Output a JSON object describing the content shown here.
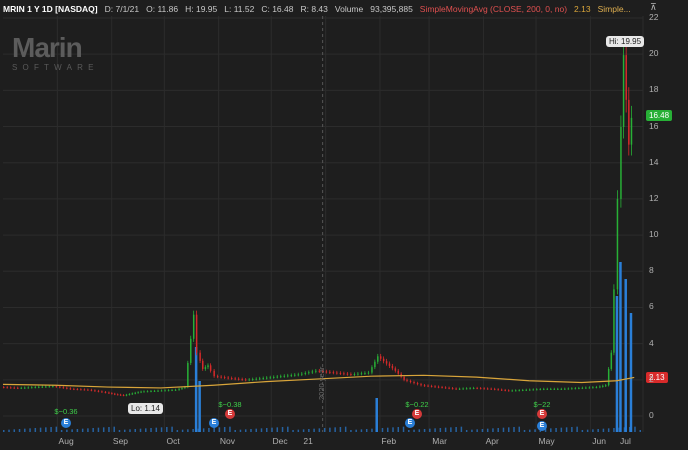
{
  "header": {
    "symbol": "MRIN 1 Y 1D [NASDAQ]",
    "date": "D: 7/1/21",
    "open": "O: 11.86",
    "high": "H: 19.95",
    "low": "L: 11.52",
    "close": "C: 16.48",
    "range": "R: 8.43",
    "volume_label": "Volume",
    "volume_value": "93,395,885",
    "study": "SimpleMovingAvg (CLOSE, 200, 0, no)",
    "study_value": "2.13",
    "study_tail": "Simple..."
  },
  "logo": {
    "word": "Marin",
    "sub": "SOFTWARE"
  },
  "corner_icon": "collapse-icon",
  "price_axis": {
    "ticks": [
      "22",
      "20",
      "18",
      "16",
      "14",
      "12",
      "10",
      "8",
      "6",
      "4",
      "2",
      "0"
    ],
    "last_price": "16.48",
    "sma_price": "2.13"
  },
  "time_axis": {
    "months": [
      "Aug",
      "Sep",
      "Oct",
      "Nov",
      "Dec",
      "21",
      "Feb",
      "Mar",
      "Apr",
      "May",
      "Jun",
      "Jul"
    ],
    "year_marker": "2020 year"
  },
  "annotations": {
    "hi": "Hi: 19.95",
    "lo": "Lo: 1.14",
    "eps": [
      "$−0.36",
      "$−0.38",
      "$−0.22",
      "$−22"
    ]
  },
  "colors": {
    "background": "#1e1e1e",
    "up": "#27b036",
    "down": "#d82a2a",
    "volume": "#2a7fd8",
    "sma": "#d9a53a",
    "grid": "#2c2c2c"
  },
  "chart_data": {
    "type": "line",
    "x_start": "2020-07-01",
    "x_end": "2021-07-01",
    "ylim": [
      0,
      22
    ],
    "price": [
      [
        0,
        1.6
      ],
      [
        10,
        1.55
      ],
      [
        20,
        1.6
      ],
      [
        30,
        1.65
      ],
      [
        40,
        1.5
      ],
      [
        50,
        1.45
      ],
      [
        60,
        1.3
      ],
      [
        65,
        1.2
      ],
      [
        70,
        1.14
      ],
      [
        75,
        1.25
      ],
      [
        80,
        1.35
      ],
      [
        90,
        1.4
      ],
      [
        100,
        1.45
      ],
      [
        105,
        1.6
      ],
      [
        110,
        5.6
      ],
      [
        112,
        3.5
      ],
      [
        115,
        2.6
      ],
      [
        118,
        2.8
      ],
      [
        122,
        2.2
      ],
      [
        130,
        2.1
      ],
      [
        140,
        2.0
      ],
      [
        150,
        2.1
      ],
      [
        160,
        2.2
      ],
      [
        170,
        2.3
      ],
      [
        180,
        2.5
      ],
      [
        190,
        2.4
      ],
      [
        200,
        2.3
      ],
      [
        210,
        2.4
      ],
      [
        215,
        3.3
      ],
      [
        220,
        2.9
      ],
      [
        225,
        2.5
      ],
      [
        230,
        2.0
      ],
      [
        240,
        1.7
      ],
      [
        250,
        1.6
      ],
      [
        260,
        1.5
      ],
      [
        270,
        1.55
      ],
      [
        280,
        1.5
      ],
      [
        290,
        1.4
      ],
      [
        300,
        1.45
      ],
      [
        310,
        1.5
      ],
      [
        320,
        1.5
      ],
      [
        330,
        1.55
      ],
      [
        340,
        1.6
      ],
      [
        345,
        1.7
      ],
      [
        348,
        3.5
      ],
      [
        350,
        7.0
      ],
      [
        352,
        12.0
      ],
      [
        355,
        19.95
      ],
      [
        358,
        15.0
      ],
      [
        360,
        16.48
      ]
    ],
    "sma": [
      [
        0,
        1.75
      ],
      [
        30,
        1.7
      ],
      [
        60,
        1.6
      ],
      [
        90,
        1.55
      ],
      [
        120,
        1.7
      ],
      [
        150,
        1.9
      ],
      [
        180,
        2.05
      ],
      [
        210,
        2.2
      ],
      [
        240,
        2.25
      ],
      [
        270,
        2.15
      ],
      [
        300,
        1.95
      ],
      [
        330,
        1.85
      ],
      [
        350,
        1.95
      ],
      [
        360,
        2.13
      ]
    ],
    "volume_spikes": [
      [
        110,
        0.5
      ],
      [
        112,
        0.3
      ],
      [
        213,
        0.2
      ],
      [
        350,
        0.8
      ],
      [
        352,
        1.0
      ],
      [
        355,
        0.9
      ],
      [
        358,
        0.7
      ]
    ]
  }
}
